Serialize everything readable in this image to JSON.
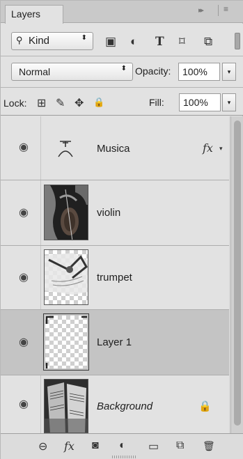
{
  "panel": {
    "tab_label": "Layers",
    "tab_close_glyph": "×",
    "collapse_glyph": "▸▸",
    "menu_glyph": "≡"
  },
  "filter": {
    "kind_label": "Kind",
    "search_icon_glyph": "⚲",
    "select_arrow_glyph": "⬍",
    "icons": [
      {
        "name": "pixel-layer-filter-icon",
        "glyph": "▣"
      },
      {
        "name": "adjustment-layer-filter-icon",
        "glyph": "◐"
      },
      {
        "name": "type-layer-filter-icon",
        "glyph": "T"
      },
      {
        "name": "shape-layer-filter-icon",
        "glyph": "⌑"
      },
      {
        "name": "smart-object-filter-icon",
        "glyph": "⧉"
      }
    ]
  },
  "blend": {
    "mode": "Normal",
    "select_arrow_glyph": "⬍",
    "opacity_label": "Opacity:",
    "opacity_value": "100%",
    "drop_glyph": "▾"
  },
  "lock": {
    "label": "Lock:",
    "icons": [
      {
        "name": "lock-transparent-pixels-icon",
        "glyph": "⊞"
      },
      {
        "name": "lock-image-pixels-icon",
        "glyph": "✎"
      },
      {
        "name": "lock-position-icon",
        "glyph": "✥"
      },
      {
        "name": "lock-all-icon",
        "glyph": "🔒"
      }
    ],
    "fill_label": "Fill:",
    "fill_value": "100%",
    "drop_glyph": "▾"
  },
  "layers": [
    {
      "name": "Musica",
      "type": "text",
      "fx": "fx",
      "fx_arrow": "▾",
      "selected": false
    },
    {
      "name": "violin",
      "type": "image",
      "selected": false
    },
    {
      "name": "trumpet",
      "type": "image",
      "selected": false
    },
    {
      "name": "Layer 1",
      "type": "empty",
      "selected": true
    },
    {
      "name": "Background",
      "type": "image",
      "locked": true,
      "lock_glyph": "🔒",
      "selected": false
    }
  ],
  "eye_glyph": "◉",
  "bottom_bar": {
    "icons": [
      {
        "name": "link-layers-icon",
        "glyph": "⊖"
      },
      {
        "name": "add-layer-style-icon",
        "glyph": "fx"
      },
      {
        "name": "add-layer-mask-icon",
        "glyph": "◙"
      },
      {
        "name": "new-adjustment-layer-icon",
        "glyph": "◐"
      },
      {
        "name": "new-group-icon",
        "glyph": "▭"
      },
      {
        "name": "new-layer-icon",
        "glyph": "⧉"
      },
      {
        "name": "delete-layer-icon",
        "glyph": "🗑"
      }
    ]
  },
  "colors": {
    "panel_bg": "#e2e2e2",
    "selected_layer_bg": "#c4c4c4",
    "tabbar_bg": "#c9c9c9"
  }
}
